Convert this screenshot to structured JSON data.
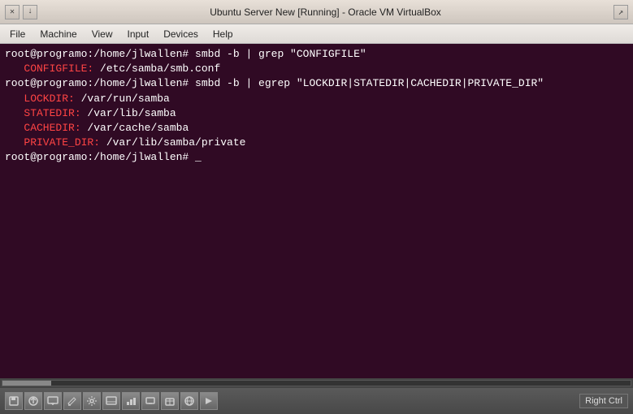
{
  "titlebar": {
    "title": "Ubuntu Server New [Running] - Oracle VM VirtualBox",
    "close_icon": "✕",
    "min_icon": "↓",
    "restore_icon": "↗"
  },
  "menubar": {
    "items": [
      "File",
      "Machine",
      "View",
      "Input",
      "Devices",
      "Help"
    ]
  },
  "terminal": {
    "lines": [
      {
        "type": "prompt",
        "text": "root@programo:/home/jlwallen# smbd -b | grep \"CONFIGFILE\""
      },
      {
        "type": "output_red_white",
        "red": "CONFIGFILE:",
        "white": " /etc/samba/smb.conf"
      },
      {
        "type": "prompt",
        "text": "root@programo:/home/jlwallen# smbd -b | egrep \"LOCKDIR|STATEDIR|CACHEDIR|PRIVATE_DIR\""
      },
      {
        "type": "output_red_white",
        "red": "LOCKDIR:",
        "white": " /var/run/samba"
      },
      {
        "type": "output_red_white",
        "red": "STATEDIR:",
        "white": " /var/lib/samba"
      },
      {
        "type": "output_red_white",
        "red": "CACHEDIR:",
        "white": " /var/cache/samba"
      },
      {
        "type": "output_red_white",
        "red": "PRIVATE_DIR:",
        "white": " /var/lib/samba/private"
      },
      {
        "type": "prompt_cursor",
        "text": "root@programo:/home/jlwallen# _"
      }
    ]
  },
  "statusbar": {
    "icons": [
      "💾",
      "⬆",
      "🖥",
      "✏",
      "🔧",
      "📺",
      "📊",
      "🖵",
      "📦",
      "🌐",
      "▶"
    ],
    "right_ctrl_label": "Right Ctrl"
  }
}
